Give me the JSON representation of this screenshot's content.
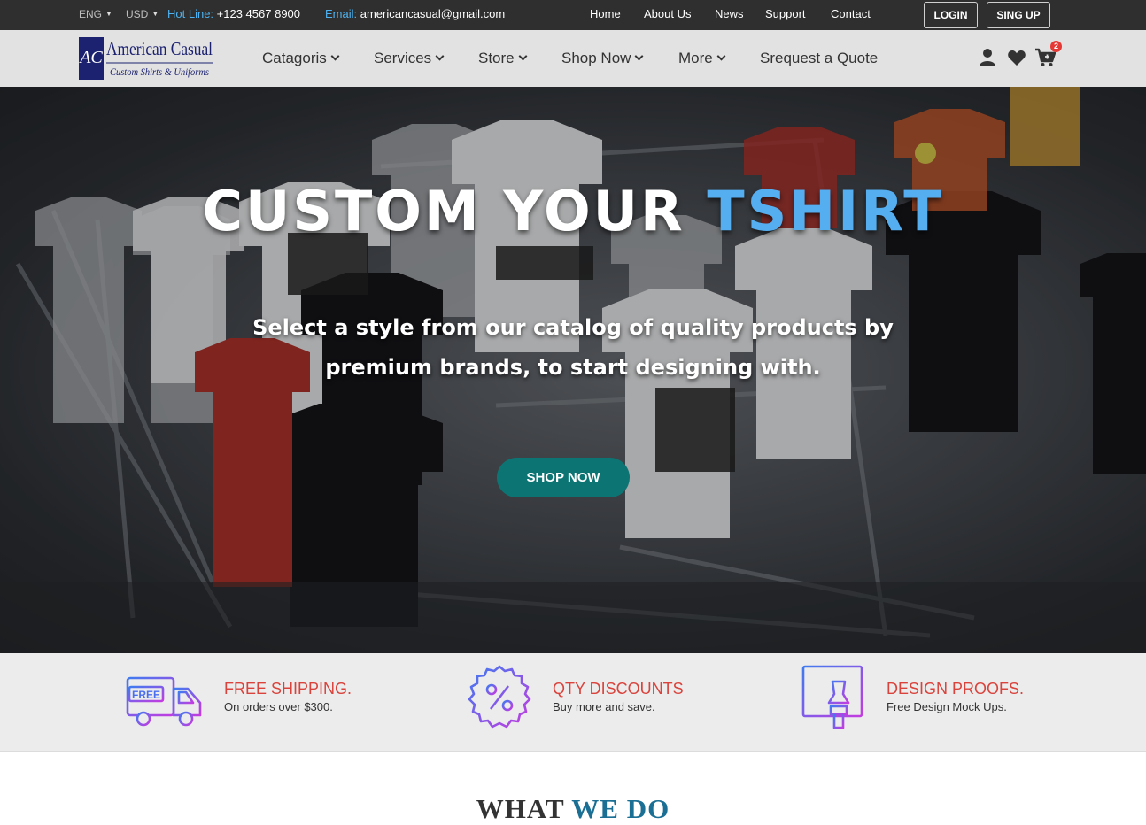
{
  "topbar": {
    "lang": "ENG",
    "currency": "USD",
    "hotline_label": "Hot Line:",
    "hotline_value": " +123 4567 8900",
    "email_label": "Email:",
    "email_value": " americancasual@gmail.com",
    "nav": [
      "Home",
      "About Us",
      "News",
      "Support",
      "Contact"
    ],
    "login": "LOGIN",
    "signup": "SING UP"
  },
  "brand": {
    "initials": "AC",
    "name": "American Casual",
    "tagline": "Custom Shirts & Uniforms"
  },
  "mainnav": {
    "items": [
      "Catagoris",
      "Services",
      "Store",
      "Shop Now",
      "More"
    ],
    "quote": "Srequest a Quote",
    "cart_count": "2",
    "icons": [
      "user-icon",
      "heart-icon",
      "cart-icon"
    ]
  },
  "hero": {
    "title_main": "CUSTOM YOUR ",
    "title_accent": "TSHIRT",
    "subtitle": "Select a style from our catalog of quality products by premium brands, to start designing with.",
    "cta": "SHOP NOW",
    "accent_color": "#55aef0",
    "cta_color": "#0d7474"
  },
  "features": [
    {
      "title": "FREE SHIPPING.",
      "desc": "On orders over $300.",
      "icon": "truck-icon",
      "badge": "FREE"
    },
    {
      "title": "QTY DISCOUNTS",
      "desc": "Buy more and save.",
      "icon": "percent-icon"
    },
    {
      "title": "DESIGN PROOFS.",
      "desc": "Free Design Mock Ups.",
      "icon": "design-icon"
    }
  ],
  "section": {
    "title_main": "WHAT ",
    "title_accent": "WE DO"
  }
}
